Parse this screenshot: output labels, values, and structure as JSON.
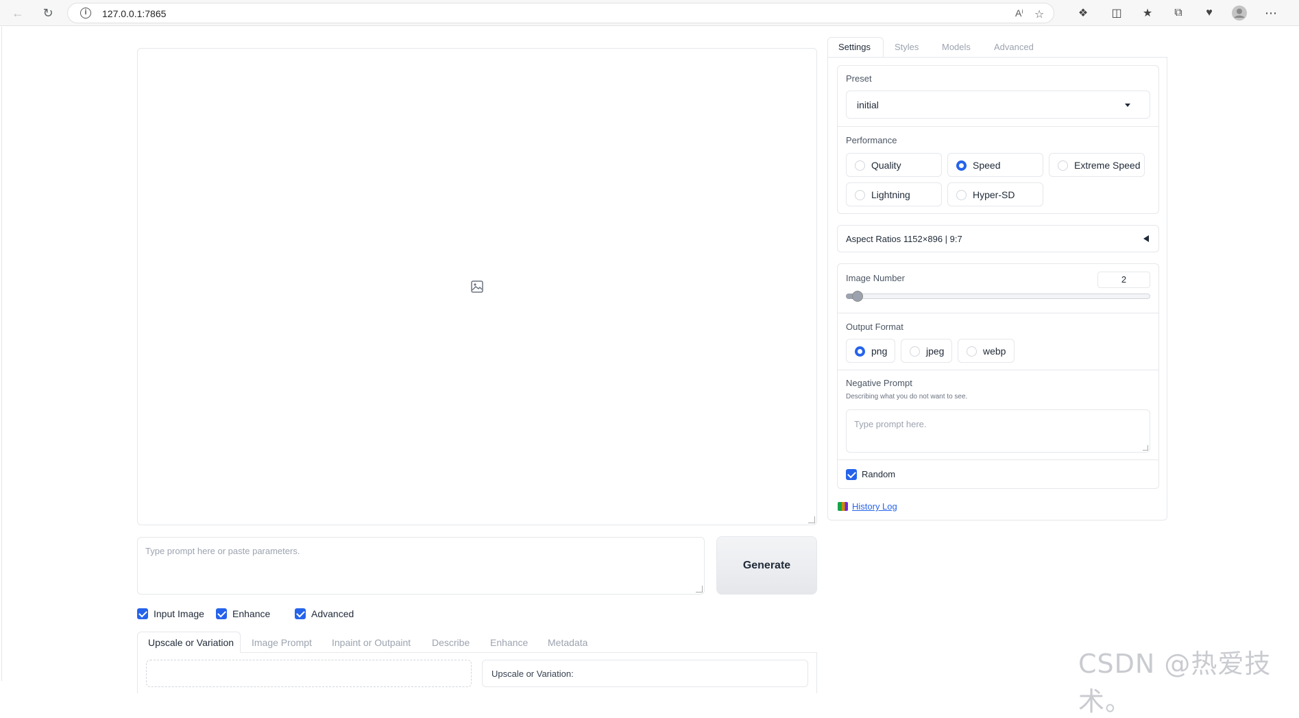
{
  "browser": {
    "url": "127.0.0.1:7865"
  },
  "main": {
    "prompt_placeholder": "Type prompt here or paste parameters.",
    "generate_label": "Generate",
    "toggles": [
      {
        "label": "Input Image",
        "checked": true
      },
      {
        "label": "Enhance",
        "checked": true
      },
      {
        "label": "Advanced",
        "checked": true
      }
    ],
    "bottom_tabs": [
      "Upscale or Variation",
      "Image Prompt",
      "Inpaint or Outpaint",
      "Describe",
      "Enhance",
      "Metadata"
    ],
    "active_bottom_tab": "Upscale or Variation",
    "upscale_label": "Upscale or Variation:"
  },
  "settings": {
    "tabs": [
      "Settings",
      "Styles",
      "Models",
      "Advanced"
    ],
    "active_tab": "Settings",
    "preset_label": "Preset",
    "preset_value": "initial",
    "performance_label": "Performance",
    "performance_options": [
      "Quality",
      "Speed",
      "Extreme Speed",
      "Lightning",
      "Hyper-SD"
    ],
    "performance_selected": "Speed",
    "aspect_ratios_label": "Aspect Ratios 1152×896 | 9:7",
    "image_number_label": "Image Number",
    "image_number_value": "2",
    "image_number_slider_fraction": 0.03,
    "output_format_label": "Output Format",
    "output_format_options": [
      "png",
      "jpeg",
      "webp"
    ],
    "output_format_selected": "png",
    "negative_prompt_label": "Negative Prompt",
    "negative_prompt_hint": "Describing what you do not want to see.",
    "negative_prompt_placeholder": "Type prompt here.",
    "random_label": "Random",
    "random_checked": true,
    "history_log_label": "History Log"
  },
  "watermark": "CSDN @热爱技术。",
  "colors": {
    "accent": "#2563eb",
    "border": "#e5e7eb",
    "muted_text": "#9ca3af"
  }
}
